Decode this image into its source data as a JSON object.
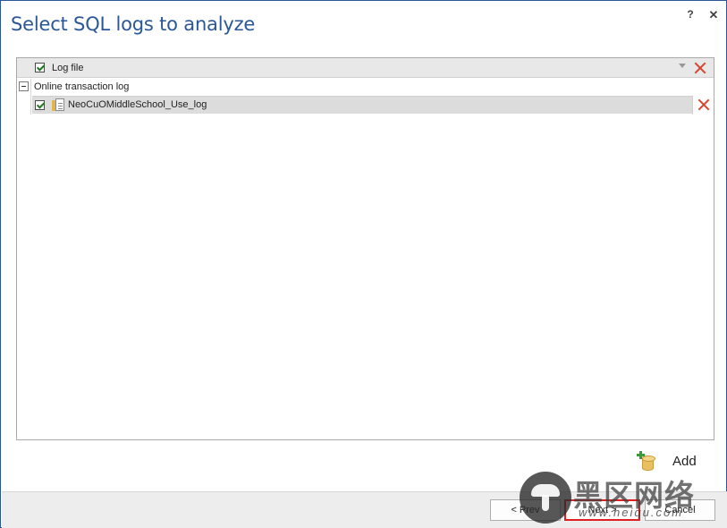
{
  "dialog": {
    "title": "Select SQL logs to analyze",
    "help_label": "?",
    "close_label": "✕"
  },
  "grid": {
    "header": {
      "checked": true,
      "column_label": "Log file"
    },
    "groups": [
      {
        "label": "Online transaction log",
        "expanded": true,
        "rows": [
          {
            "checked": true,
            "name": "NeoCuOMiddleSchool_Use_log"
          }
        ]
      }
    ]
  },
  "actions": {
    "add_label": "Add"
  },
  "footer": {
    "prev_label": "< Prev",
    "next_label": "Next >",
    "cancel_label": "Cancel"
  },
  "watermark": {
    "logo_text": "黑区网络",
    "url": "www.heiqu.com"
  },
  "colors": {
    "title": "#2b5797",
    "delete_icon": "#d9442e",
    "highlight_border": "#e02020",
    "row_selected": "#dcdcdc"
  }
}
